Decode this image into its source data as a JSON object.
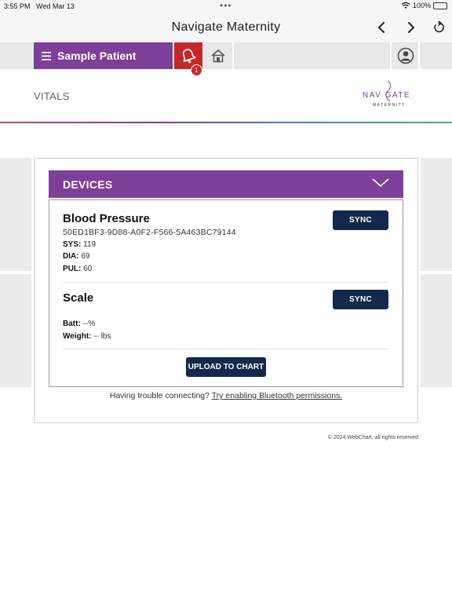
{
  "status_bar": {
    "time": "3:55 PM",
    "date": "Wed Mar 13",
    "battery": "100%"
  },
  "nav": {
    "title": "Navigate Maternity"
  },
  "header": {
    "patient_name": "Sample Patient",
    "notification_count": "1"
  },
  "page": {
    "section_title": "VITALS"
  },
  "logo": {
    "word": "NAV GATE",
    "sub": "MATERNITY"
  },
  "devices": {
    "title": "DEVICES",
    "blood_pressure": {
      "name": "Blood Pressure",
      "id": "50ED1BF3-9D88-A0F2-F566-5A463BC79144",
      "sys_label": "SYS:",
      "sys_value": "119",
      "dia_label": "DIA:",
      "dia_value": "69",
      "pul_label": "PUL:",
      "pul_value": "60",
      "sync_label": "SYNC"
    },
    "scale": {
      "name": "Scale",
      "batt_label": "Batt:",
      "batt_value": "--%",
      "weight_label": "Weight:",
      "weight_value": "-- lbs",
      "sync_label": "SYNC"
    },
    "upload_label": "UPLOAD TO CHART",
    "trouble_text": "Having trouble connecting?",
    "trouble_link": "Try enabling Bluetooth permissions."
  },
  "footer": {
    "copyright": "© 2024 WebChart, all rights reserved"
  },
  "colors": {
    "brand_purple": "#7d3f98",
    "alert_red": "#c62828",
    "button_navy": "#13294b"
  }
}
